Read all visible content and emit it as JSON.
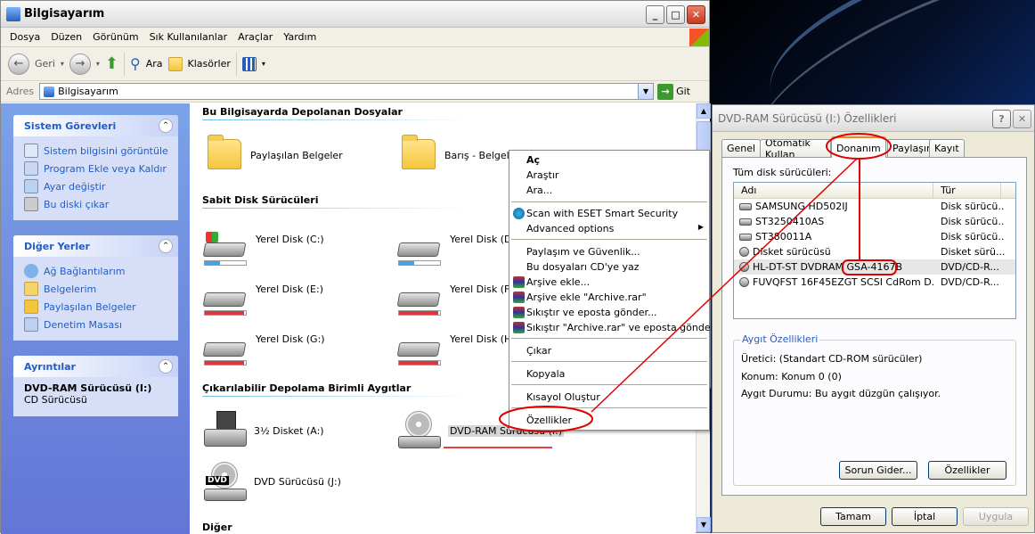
{
  "explorer": {
    "title": "Bilgisayarım",
    "menu": [
      "Dosya",
      "Düzen",
      "Görünüm",
      "Sık Kullanılanlar",
      "Araçlar",
      "Yardım"
    ],
    "toolbar": {
      "back": "Geri",
      "search": "Ara",
      "folders": "Klasörler"
    },
    "address": {
      "label": "Adres",
      "value": "Bilgisayarım",
      "go": "Git"
    },
    "left": {
      "tasks": {
        "title": "Sistem Görevleri",
        "items": [
          "Sistem bilgisini görüntüle",
          "Program Ekle veya Kaldır",
          "Ayar değiştir",
          "Bu diski çıkar"
        ]
      },
      "places": {
        "title": "Diğer Yerler",
        "items": [
          "Ağ Bağlantılarım",
          "Belgelerim",
          "Paylaşılan Belgeler",
          "Denetim Masası"
        ]
      },
      "details": {
        "title": "Ayrıntılar",
        "name": "DVD-RAM Sürücüsü (I:)",
        "type": "CD Sürücüsü"
      }
    },
    "sections": {
      "stored": "Bu Bilgisayarda Depolanan Dosyalar",
      "hdd": "Sabit Disk Sürücüleri",
      "removable": "Çıkarılabilir Depolama Birimli Aygıtlar",
      "other": "Diğer"
    },
    "folders": [
      "Paylaşılan Belgeler",
      "Barış - Belgeler"
    ],
    "disks": [
      {
        "label": "Yerel Disk (C:)",
        "fill": 0.38,
        "color": "#4aa3df"
      },
      {
        "label": "Yerel Disk (D:)",
        "fill": 0.38,
        "color": "#4aa3df"
      },
      {
        "label": "Yerel Disk (E:)",
        "fill": 0.96,
        "color": "#d9363e"
      },
      {
        "label": "Yerel Disk (F:)",
        "fill": 0.96,
        "color": "#d9363e"
      },
      {
        "label": "Yerel Disk (G:)",
        "fill": 0.96,
        "color": "#d9363e"
      },
      {
        "label": "Yerel Disk (H:)",
        "fill": 0.96,
        "color": "#d9363e"
      }
    ],
    "removable": [
      "3½ Disket (A:)",
      "DVD-RAM Sürücüsü (I:)",
      "DVD Sürücüsü (J:)"
    ]
  },
  "context_menu": {
    "items": [
      "Aç",
      "Araştır",
      "Ara...",
      "Scan with ESET Smart Security",
      "Advanced options",
      "Paylaşım ve Güvenlik...",
      "Bu dosyaları CD'ye yaz",
      "Arşive ekle...",
      "Arşive ekle \"Archive.rar\"",
      "Sıkıştır ve eposta gönder...",
      "Sıkıştır \"Archive.rar\" ve eposta gönder",
      "Çıkar",
      "Kopyala",
      "Kısayol Oluştur",
      "Özellikler"
    ]
  },
  "dialog": {
    "title": "DVD-RAM Sürücüsü (I:) Özellikleri",
    "tabs": [
      "Genel",
      "Otomatik Kullan",
      "Donanım",
      "Paylaşım",
      "Kayıt"
    ],
    "list_label": "Tüm disk sürücüleri:",
    "columns": [
      "Adı",
      "Tür"
    ],
    "rows": [
      {
        "name": "SAMSUNG HD502IJ",
        "type": "Disk sürücü..."
      },
      {
        "name": "ST3250410AS",
        "type": "Disk sürücü..."
      },
      {
        "name": "ST380011A",
        "type": "Disk sürücü..."
      },
      {
        "name": "Disket sürücüsü",
        "type": "Disket sürü..."
      },
      {
        "name": "HL-DT-ST DVDRAM GSA-4167B",
        "type": "DVD/CD-R..."
      },
      {
        "name": "FUVQFST 16F45EZGT SCSI CdRom D...",
        "type": "DVD/CD-R..."
      }
    ],
    "props": {
      "title": "Aygıt Özellikleri",
      "maker": "Üretici: (Standart CD-ROM sürücüler)",
      "location": "Konum: Konum 0 (0)",
      "status": "Aygıt Durumu: Bu aygıt düzgün çalışıyor."
    },
    "buttons": {
      "troubleshoot": "Sorun Gider...",
      "properties": "Özellikler",
      "ok": "Tamam",
      "cancel": "İptal",
      "apply": "Uygula"
    }
  },
  "colors": {
    "annotation": "#e00000",
    "selected_drive_highlight": "#e7e7e7"
  }
}
